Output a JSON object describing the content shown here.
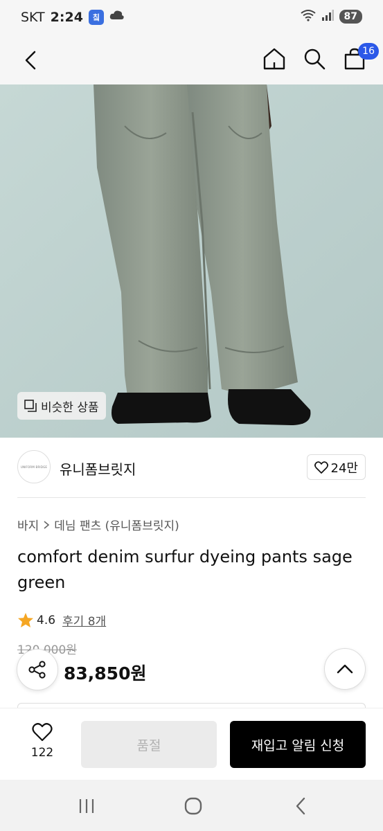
{
  "status_bar": {
    "carrier": "SKT",
    "time": "2:24",
    "app_badge": "칰",
    "battery": "87"
  },
  "header": {
    "cart_count": "16",
    "icons": [
      "back-chevron-icon",
      "home-icon",
      "search-icon",
      "cart-icon"
    ]
  },
  "image": {
    "similar_label": "비슷한 상품"
  },
  "brand": {
    "logo_text": "UNIFORM BRIDGE",
    "name": "유니폼브릿지",
    "likes": "24만"
  },
  "breadcrumb": {
    "category": "바지",
    "subcategory": "데님 팬츠 (유니폼브릿지)"
  },
  "product": {
    "title": "comfort denim surfur dyeing pants sage green",
    "rating": "4.6",
    "reviews": "후기 8개",
    "original_price": "120,000원",
    "sale_price": "83,850원"
  },
  "actions": {
    "wish_count": "122",
    "soldout_label": "품절",
    "restock_label": "재입고 알림 신청"
  },
  "colors": {
    "accent": "#2b58e8",
    "star": "#f5a623",
    "primary_button": "#000000",
    "image_background": "#bfd2cf"
  }
}
